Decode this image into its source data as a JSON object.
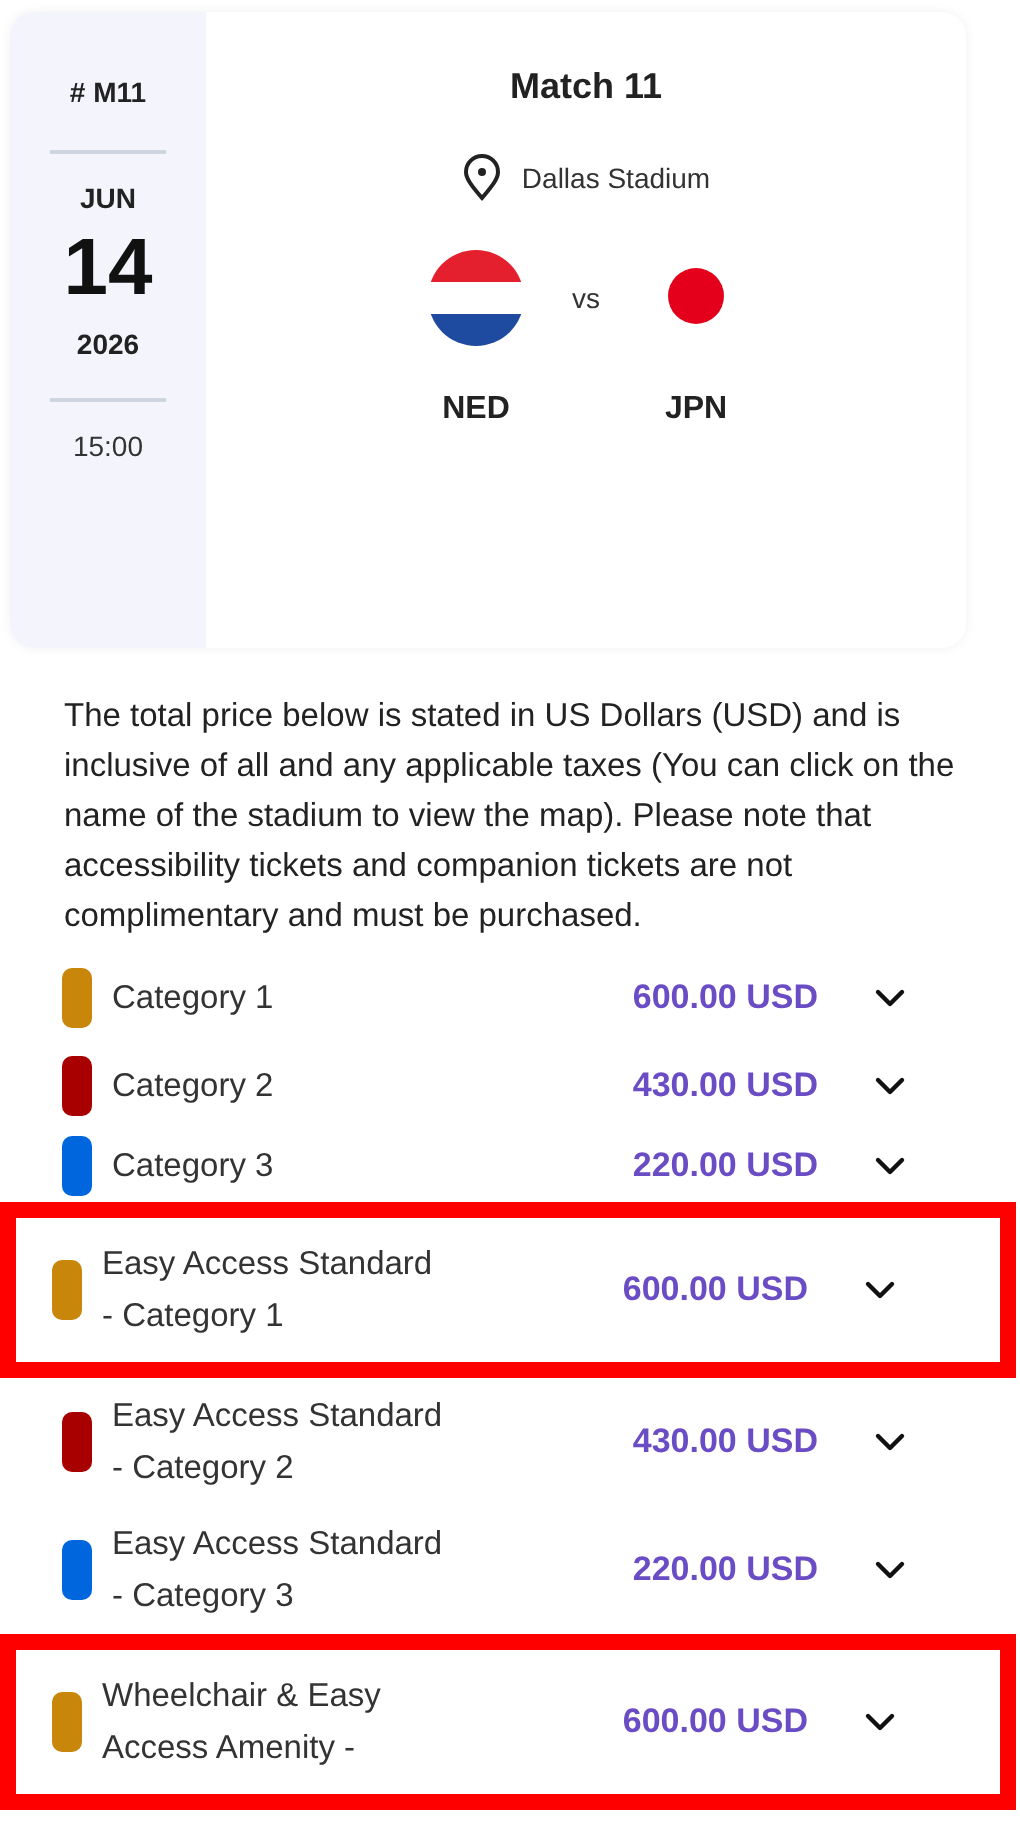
{
  "match": {
    "number": "# M11",
    "month": "JUN",
    "day": "14",
    "year": "2026",
    "time": "15:00",
    "title": "Match 11",
    "venue": "Dallas Stadium",
    "separator": "vs",
    "teams": [
      {
        "code": "NED",
        "kind": "tricolor"
      },
      {
        "code": "JPN",
        "kind": "disc"
      }
    ]
  },
  "note": "The total price below is stated in US Dollars (USD) and is inclusive of all and any applicable taxes (You can click on the name of the stadium to view the map). Please note that accessibility tickets and companion tickets are not complimentary and must be purchased.",
  "categories": [
    {
      "name": "Category 1",
      "price": "600.00 USD",
      "color": "#c8860a",
      "highlighted": false
    },
    {
      "name": "Category 2",
      "price": "430.00 USD",
      "color": "#a80000",
      "highlighted": false
    },
    {
      "name": "Category 3",
      "price": "220.00 USD",
      "color": "#0066dd",
      "highlighted": false
    },
    {
      "name": "Easy Access Standard - Category 1",
      "price": "600.00 USD",
      "color": "#c8860a",
      "highlighted": true
    },
    {
      "name": "Easy Access Standard - Category 2",
      "price": "430.00 USD",
      "color": "#a80000",
      "highlighted": false
    },
    {
      "name": "Easy Access Standard - Category 3",
      "price": "220.00 USD",
      "color": "#0066dd",
      "highlighted": false
    },
    {
      "name": "Wheelchair & Easy Access Amenity -",
      "price": "600.00 USD",
      "color": "#c8860a",
      "highlighted": true
    }
  ]
}
